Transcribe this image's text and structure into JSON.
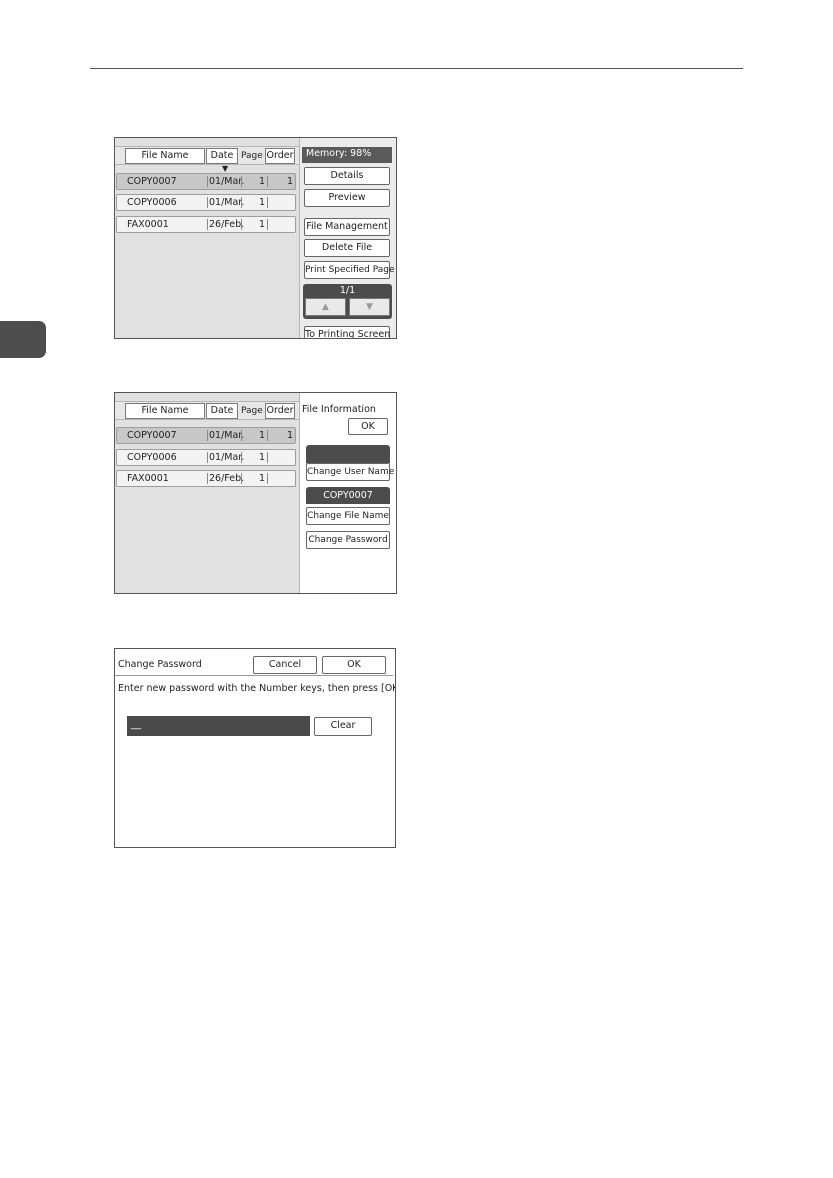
{
  "screen1": {
    "header": {
      "file_name": "File Name",
      "date": "Date",
      "page": "Page",
      "order": "Order"
    },
    "sort_icon": "down-triangle",
    "rows": [
      {
        "name": "COPY0007",
        "date": "01/Mar.",
        "page": "1",
        "order": "1"
      },
      {
        "name": "COPY0006",
        "date": "01/Mar.",
        "page": "1",
        "order": ""
      },
      {
        "name": "FAX0001",
        "date": "26/Feb.",
        "page": "1",
        "order": ""
      }
    ],
    "memory": "Memory:  98%",
    "buttons": {
      "details": "Details",
      "preview": "Preview",
      "file_management": "File Management",
      "delete_file": "Delete File",
      "print_specified_page": "Print Specified Page",
      "to_printing_screen": "To Printing Screen"
    },
    "page_counter": "1/1",
    "up_arrow": "▲",
    "down_arrow": "▼"
  },
  "screen2": {
    "header": {
      "file_name": "File Name",
      "date": "Date",
      "page": "Page",
      "order": "Order"
    },
    "rows": [
      {
        "name": "COPY0007",
        "date": "01/Mar.",
        "page": "1",
        "order": "1"
      },
      {
        "name": "COPY0006",
        "date": "01/Mar.",
        "page": "1",
        "order": ""
      },
      {
        "name": "FAX0001",
        "date": "26/Feb.",
        "page": "1",
        "order": ""
      }
    ],
    "panel_title": "File Information",
    "ok": "OK",
    "user_name_value": "",
    "change_user_name": "Change User Name",
    "file_name_value": "COPY0007",
    "change_file_name": "Change File Name",
    "change_password": "Change Password"
  },
  "screen3": {
    "title": "Change Password",
    "cancel": "Cancel",
    "ok": "OK",
    "instruction": "Enter new password with the Number keys, then press [OK].",
    "password_value": "__",
    "clear": "Clear"
  },
  "colors": {
    "dark_panel": "#4c4c4c",
    "selected_row": "#c8c8c8",
    "screen_bg": "#e1e1e1"
  }
}
